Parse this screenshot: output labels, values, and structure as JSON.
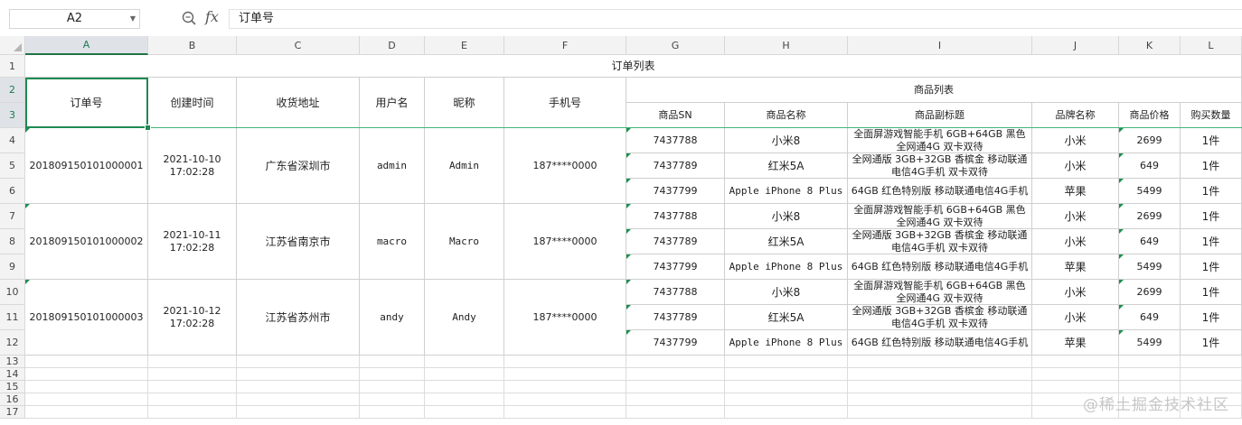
{
  "formula_bar": {
    "name_box": "A2",
    "fx_label": "fx",
    "formula": "订单号"
  },
  "columns": [
    "A",
    "B",
    "C",
    "D",
    "E",
    "F",
    "G",
    "H",
    "I",
    "J",
    "K",
    "L"
  ],
  "rows": [
    "1",
    "2",
    "3",
    "4",
    "5",
    "6",
    "7",
    "8",
    "9",
    "10",
    "11",
    "12",
    "13",
    "14",
    "15",
    "16",
    "17"
  ],
  "sheet": {
    "title": "订单列表",
    "headers": {
      "order_no": "订单号",
      "created": "创建时间",
      "address": "收货地址",
      "username": "用户名",
      "nickname": "昵称",
      "phone": "手机号",
      "products": "商品列表",
      "sn": "商品SN",
      "name": "商品名称",
      "subtitle": "商品副标题",
      "brand": "品牌名称",
      "price": "商品价格",
      "qty": "购买数量"
    },
    "orders": [
      {
        "order_no": "201809150101000001",
        "created_date": "2021-10-10",
        "created_time": "17:02:28",
        "address": "广东省深圳市",
        "username": "admin",
        "nickname": "Admin",
        "phone": "187****0000",
        "items": [
          {
            "sn": "7437788",
            "name": "小米8",
            "subtitle": "全面屏游戏智能手机 6GB+64GB 黑色 全网通4G 双卡双待",
            "brand": "小米",
            "price": "2699",
            "qty": "1件"
          },
          {
            "sn": "7437789",
            "name": "红米5A",
            "subtitle": "全网通版 3GB+32GB 香槟金 移动联通电信4G手机 双卡双待",
            "brand": "小米",
            "price": "649",
            "qty": "1件"
          },
          {
            "sn": "7437799",
            "name": "Apple iPhone 8 Plus",
            "subtitle": "64GB 红色特别版 移动联通电信4G手机",
            "brand": "苹果",
            "price": "5499",
            "qty": "1件"
          }
        ]
      },
      {
        "order_no": "201809150101000002",
        "created_date": "2021-10-11",
        "created_time": "17:02:28",
        "address": "江苏省南京市",
        "username": "macro",
        "nickname": "Macro",
        "phone": "187****0000",
        "items": [
          {
            "sn": "7437788",
            "name": "小米8",
            "subtitle": "全面屏游戏智能手机 6GB+64GB 黑色 全网通4G 双卡双待",
            "brand": "小米",
            "price": "2699",
            "qty": "1件"
          },
          {
            "sn": "7437789",
            "name": "红米5A",
            "subtitle": "全网通版 3GB+32GB 香槟金 移动联通电信4G手机 双卡双待",
            "brand": "小米",
            "price": "649",
            "qty": "1件"
          },
          {
            "sn": "7437799",
            "name": "Apple iPhone 8 Plus",
            "subtitle": "64GB 红色特别版 移动联通电信4G手机",
            "brand": "苹果",
            "price": "5499",
            "qty": "1件"
          }
        ]
      },
      {
        "order_no": "201809150101000003",
        "created_date": "2021-10-12",
        "created_time": "17:02:28",
        "address": "江苏省苏州市",
        "username": "andy",
        "nickname": "Andy",
        "phone": "187****0000",
        "items": [
          {
            "sn": "7437788",
            "name": "小米8",
            "subtitle": "全面屏游戏智能手机 6GB+64GB 黑色 全网通4G 双卡双待",
            "brand": "小米",
            "price": "2699",
            "qty": "1件"
          },
          {
            "sn": "7437789",
            "name": "红米5A",
            "subtitle": "全网通版 3GB+32GB 香槟金 移动联通电信4G手机 双卡双待",
            "brand": "小米",
            "price": "649",
            "qty": "1件"
          },
          {
            "sn": "7437799",
            "name": "Apple iPhone 8 Plus",
            "subtitle": "64GB 红色特别版 移动联通电信4G手机",
            "brand": "苹果",
            "price": "5499",
            "qty": "1件"
          }
        ]
      }
    ]
  },
  "watermark": "@稀土掘金技术社区",
  "colors": {
    "accent": "#1f8a52",
    "header_bg": "#f3f3f3"
  }
}
